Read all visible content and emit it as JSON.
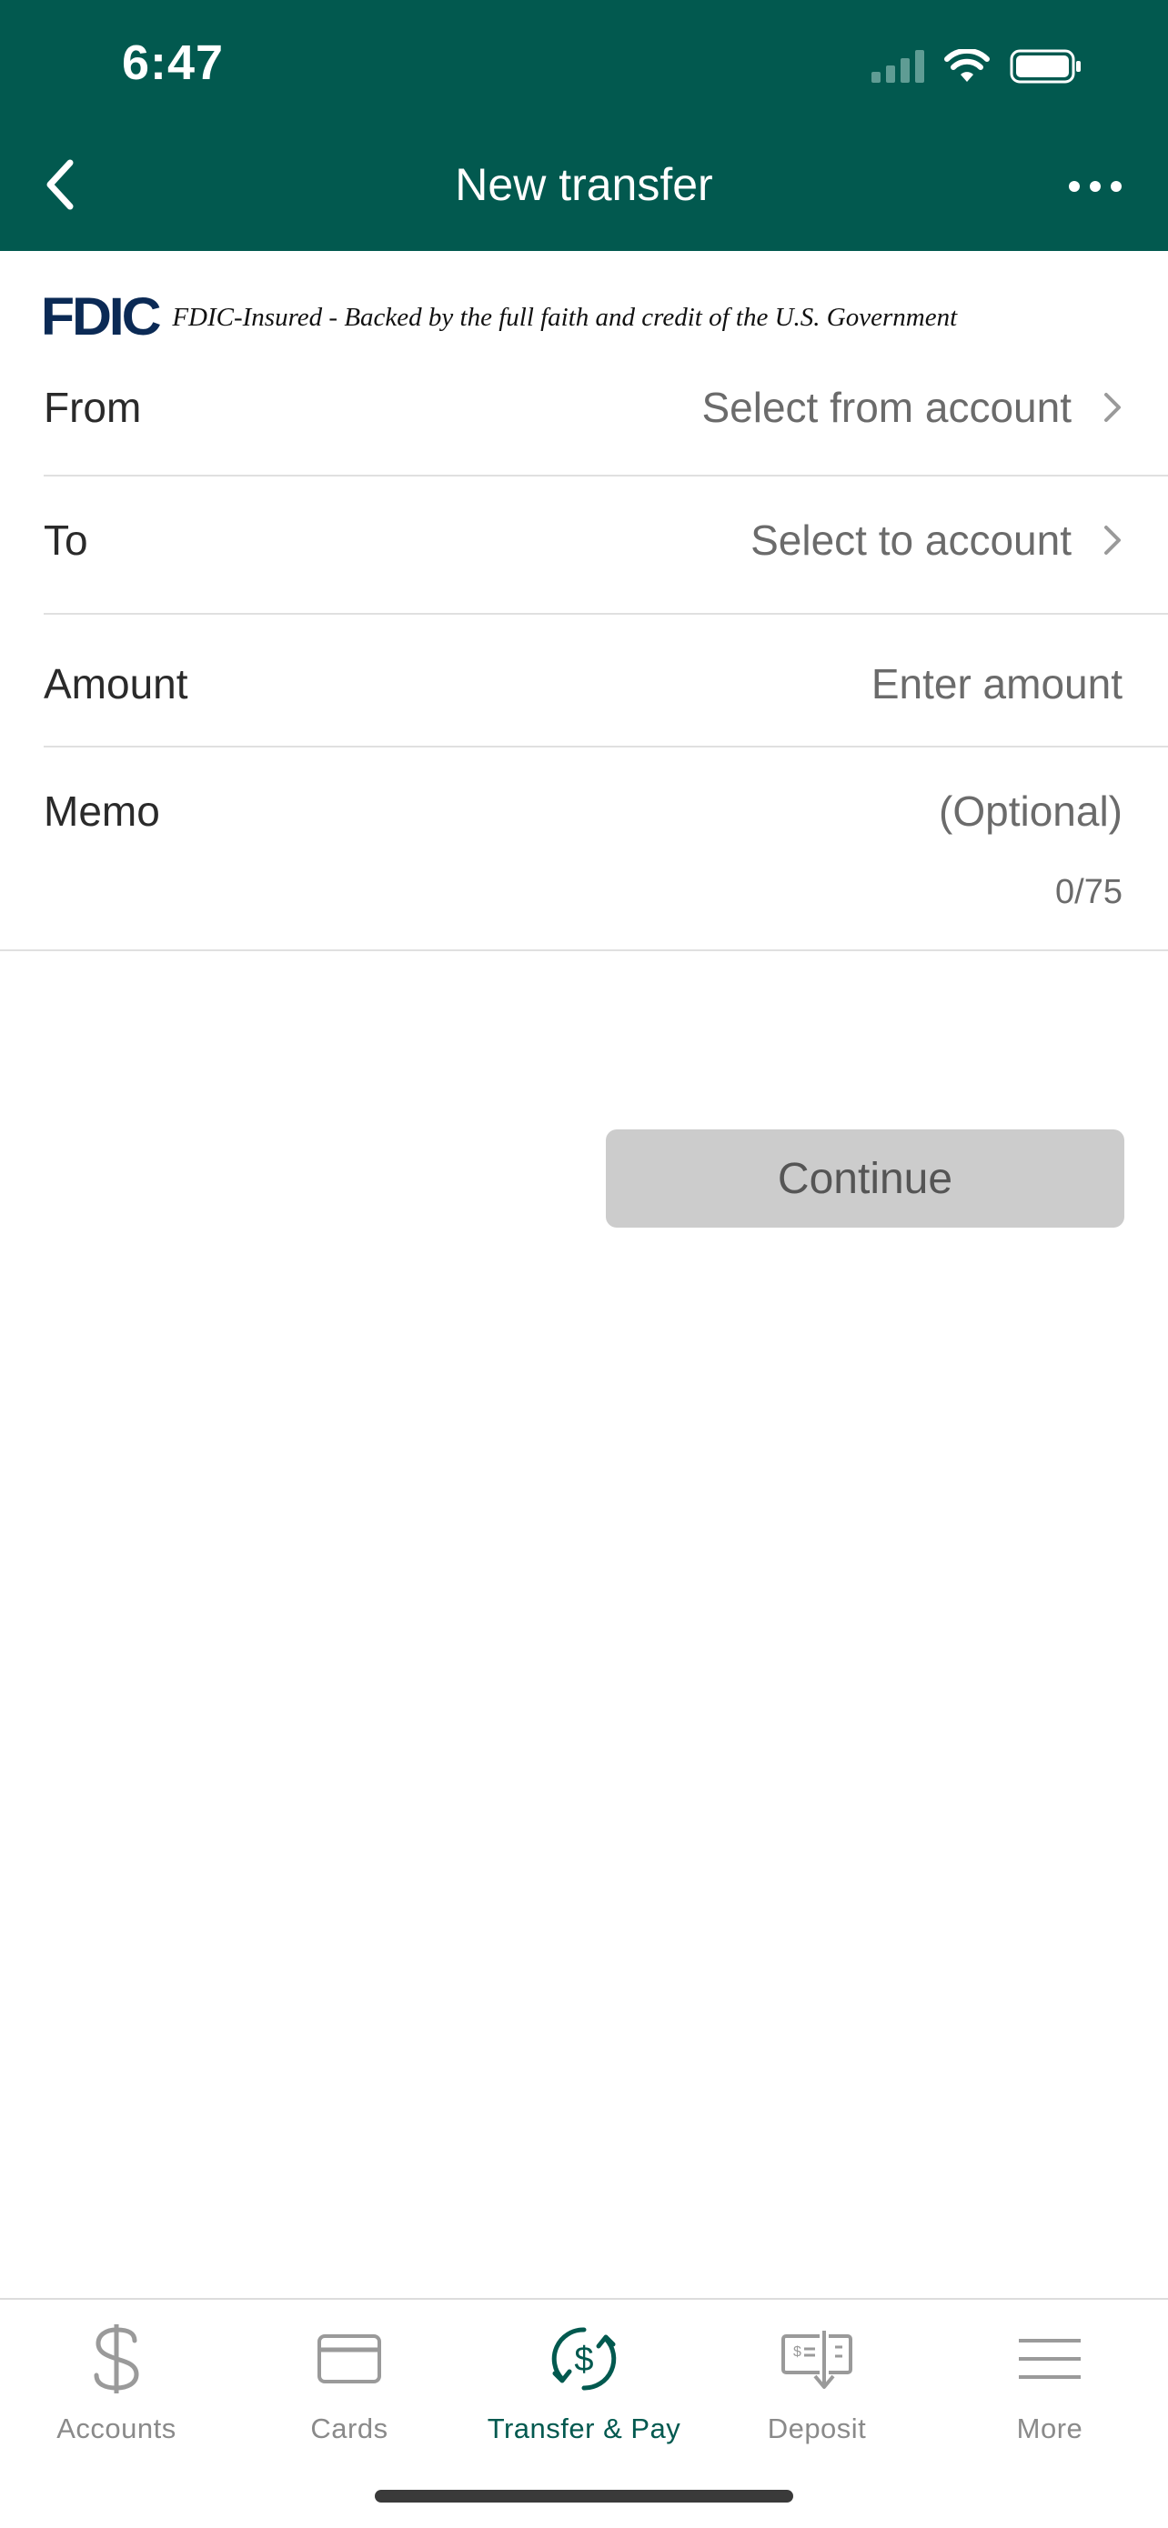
{
  "status": {
    "time": "6:47"
  },
  "nav": {
    "title": "New transfer"
  },
  "fdic": {
    "logo": "FDIC",
    "text": "FDIC-Insured - Backed by the full faith and credit of the U.S. Government"
  },
  "form": {
    "from": {
      "label": "From",
      "value": "Select from account"
    },
    "to": {
      "label": "To",
      "value": "Select to account"
    },
    "amount": {
      "label": "Amount",
      "placeholder": "Enter amount"
    },
    "memo": {
      "label": "Memo",
      "placeholder": "(Optional)",
      "counter": "0/75"
    }
  },
  "continue_label": "Continue",
  "tabs": [
    {
      "label": "Accounts",
      "icon": "dollar-icon"
    },
    {
      "label": "Cards",
      "icon": "card-icon"
    },
    {
      "label": "Transfer & Pay",
      "icon": "transfer-icon",
      "active": true
    },
    {
      "label": "Deposit",
      "icon": "check-deposit-icon"
    },
    {
      "label": "More",
      "icon": "menu-icon"
    }
  ],
  "colors": {
    "brand": "#02594f",
    "disabled_button": "#cccccc",
    "logo": "#0b2a55"
  }
}
